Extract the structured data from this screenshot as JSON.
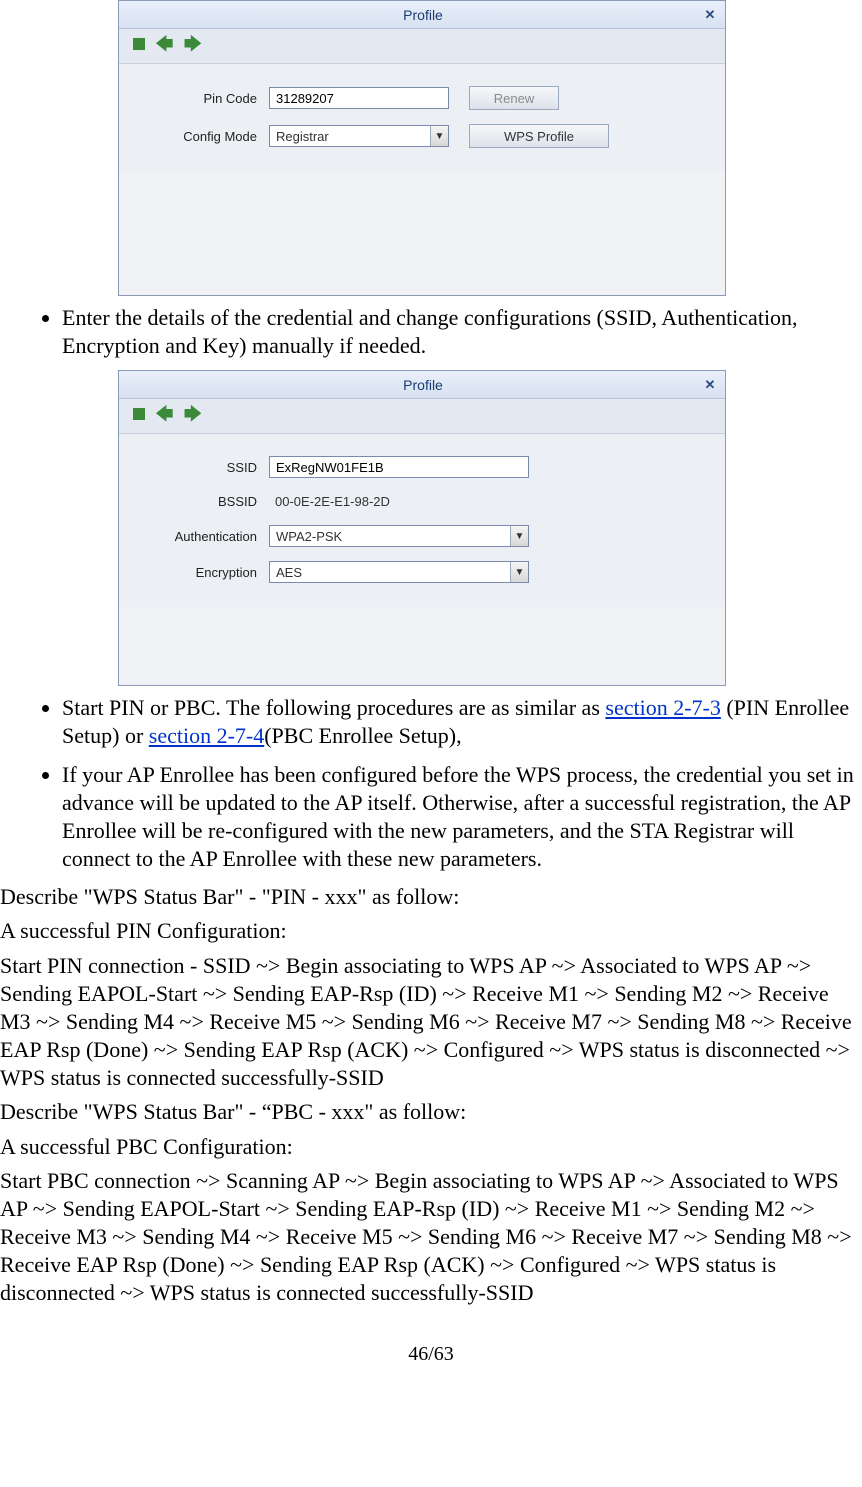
{
  "dialog1": {
    "title": "Profile",
    "pin_label": "Pin Code",
    "pin_value": "31289207",
    "renew_label": "Renew",
    "config_label": "Config Mode",
    "config_value": "Registrar",
    "wps_profile_label": "WPS Profile"
  },
  "bullets_top": {
    "b1": "Enter the details of the credential and change configurations (SSID, Authentication, Encryption and Key) manually if needed."
  },
  "dialog2": {
    "title": "Profile",
    "ssid_label": "SSID",
    "ssid_value": "ExRegNW01FE1B",
    "bssid_label": "BSSID",
    "bssid_value": "00-0E-2E-E1-98-2D",
    "auth_label": "Authentication",
    "auth_value": "WPA2-PSK",
    "enc_label": "Encryption",
    "enc_value": "AES"
  },
  "bullets_mid": {
    "b2_pre": "Start PIN or PBC. The following procedures are as similar as ",
    "b2_link1": "section 2-7-3",
    "b2_mid": " (PIN Enrollee Setup) or ",
    "b2_link2": "section 2-7-4",
    "b2_post": "(PBC Enrollee Setup),",
    "b3": "If your AP Enrollee has been configured before the WPS process, the credential you set in advance will be updated to the AP itself. Otherwise, after a successful registration, the AP Enrollee will be re-configured with the new parameters, and the STA Registrar will connect to the AP Enrollee with these new parameters."
  },
  "body": {
    "p1": "Describe \"WPS Status Bar\" - \"PIN - xxx\" as follow:",
    "p2": "A successful PIN Configuration:",
    "p3": "Start PIN connection - SSID ~> Begin associating to WPS AP ~> Associated to WPS AP ~> Sending EAPOL-Start ~> Sending EAP-Rsp (ID) ~> Receive M1 ~> Sending M2 ~> Receive M3 ~> Sending M4 ~> Receive M5 ~> Sending M6 ~> Receive M7 ~> Sending M8 ~> Receive EAP Rsp (Done) ~> Sending EAP Rsp (ACK) ~> Configured ~> WPS status is disconnected ~> WPS status is connected successfully-SSID",
    "p4": "Describe \"WPS Status Bar\" - “PBC - xxx\" as follow:",
    "p5": "A successful PBC Configuration:",
    "p6": "Start PBC connection ~> Scanning AP ~> Begin associating to WPS AP ~> Associated to WPS AP ~> Sending EAPOL-Start ~> Sending EAP-Rsp (ID) ~> Receive M1 ~> Sending M2 ~> Receive M3 ~> Sending M4 ~> Receive M5 ~> Sending M6 ~> Receive M7 ~> Sending M8 ~> Receive EAP Rsp (Done) ~> Sending EAP Rsp (ACK) ~> Configured ~> WPS status is disconnected ~> WPS status is connected successfully-SSID"
  },
  "footer": "46/63"
}
